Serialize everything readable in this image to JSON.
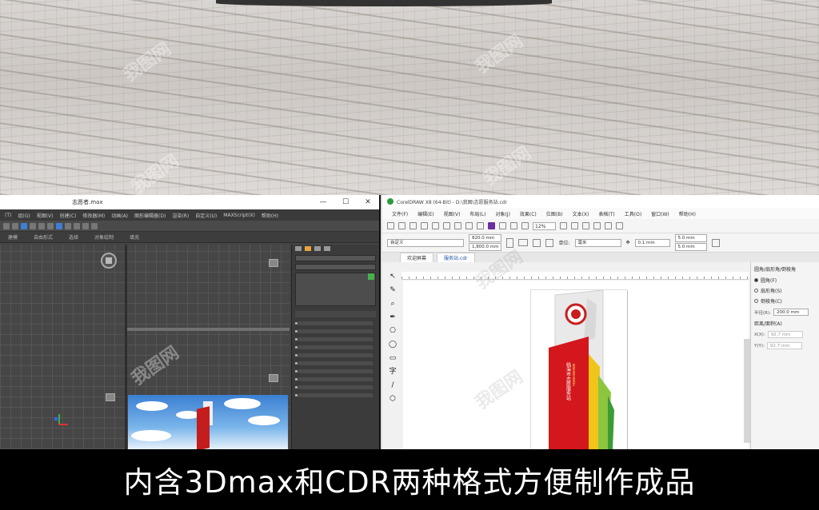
{
  "caption": "内含3Dmax和CDR两种格式方便制作成品",
  "watermark": "我图网",
  "max": {
    "title": "志愿者.max",
    "window_controls": [
      "—",
      "☐",
      "✕"
    ],
    "menus": [
      "(T)",
      "组(G)",
      "视图(V)",
      "创建(C)",
      "修改器(M)",
      "动画(A)",
      "图形编辑器(D)",
      "渲染(R)",
      "自定义(U)",
      "MAXScript(X)",
      "帮助(H)"
    ],
    "ribbon": [
      "建模",
      "自由形式",
      "选择",
      "对象绘制",
      "填充"
    ]
  },
  "cdr": {
    "title": "CorelDRAW X8 (64-Bit) - D:\\我图\\志愿服务站.cdr",
    "menus": [
      "文件(F)",
      "编辑(E)",
      "视图(V)",
      "布局(L)",
      "对象(J)",
      "效果(C)",
      "位图(B)",
      "文本(X)",
      "表格(T)",
      "工具(O)",
      "窗口(W)",
      "帮助(H)"
    ],
    "zoom": "12%",
    "preset": "自定义",
    "width": "820.0 mm",
    "height": "1,800.0 mm",
    "units_label": "单位:",
    "units": "毫米",
    "nudge": "0.1 mm",
    "dup_x": "5.0 mm",
    "dup_y": "5.0 mm",
    "tabs": [
      "欢迎屏幕",
      "服务站.cdr"
    ],
    "toolbox_icons": [
      "↖",
      "✎",
      "⌕",
      "✒",
      "⎔",
      "◯",
      "▭",
      "字",
      "∕",
      "⬡"
    ],
    "docker": {
      "title": "圆角/扇形角/倒棱角",
      "options": [
        "圆角(F)",
        "扇形角(S)",
        "倒棱角(C)"
      ],
      "radius_label": "半径(R):",
      "radius": "200.0 mm",
      "section": "距离/面积(A)",
      "field1_label": "X(X):",
      "field1": "92.7 mm",
      "field2_label": "Y(Y):",
      "field2": "92.7 mm"
    }
  }
}
